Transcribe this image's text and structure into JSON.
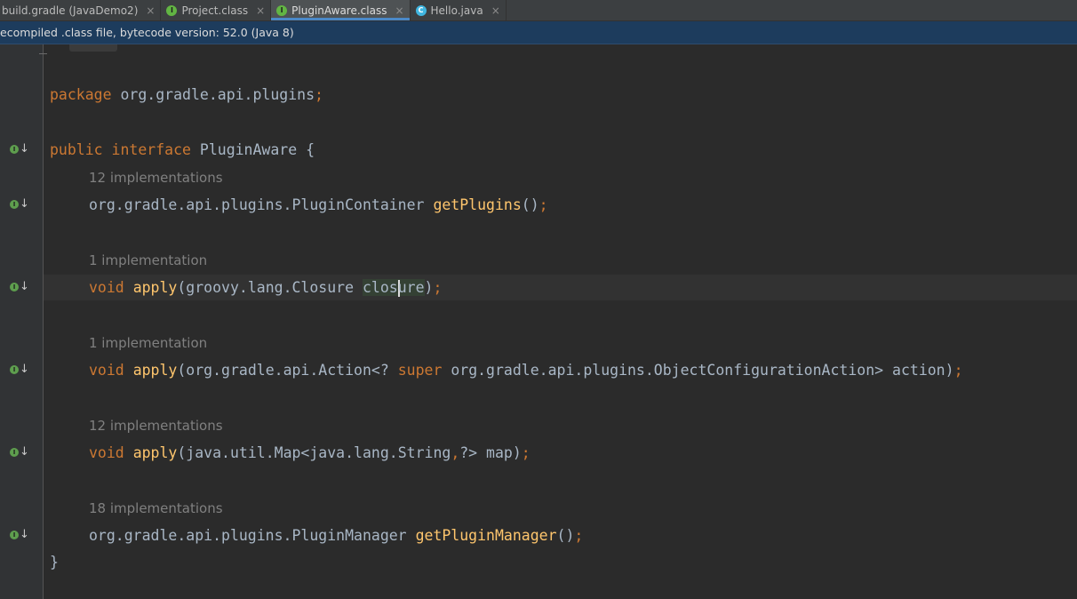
{
  "tabs": [
    {
      "label": "build.gradle (JavaDemo2)",
      "icon": "none",
      "active": false
    },
    {
      "label": "Project.class",
      "icon": "interface-icon",
      "active": false
    },
    {
      "label": "PluginAware.class",
      "icon": "interface-icon",
      "active": true
    },
    {
      "label": "Hello.java",
      "icon": "java-class-icon",
      "active": false
    }
  ],
  "tab_close_glyph": "×",
  "notice": {
    "text": "ecompiled .class file, bytecode version: 52.0 (Java 8)"
  },
  "code": {
    "package_kw": "package",
    "package_name": "org.gradle.api.plugins",
    "semi": ";",
    "public_kw": "public",
    "interface_kw": "interface",
    "iface_name": "PluginAware",
    "open_brace": "{",
    "close_brace": "}",
    "members": [
      {
        "hint": "12 implementations",
        "ret": "org.gradle.api.plugins.PluginContainer",
        "name": "getPlugins",
        "params": "()",
        "end": ";"
      },
      {
        "hint": "1 implementation",
        "ret": "void",
        "name": "apply",
        "params_pre": "(groovy.lang.Closure ",
        "param_hl_a": "clos",
        "param_hl_b": "ure",
        "params_post": ")",
        "end": ";"
      },
      {
        "hint": "1 implementation",
        "ret": "void",
        "name": "apply",
        "params_pre": "(org.gradle.api.Action<? ",
        "super_kw": "super",
        "params_post": " org.gradle.api.plugins.ObjectConfigurationAction> action)",
        "end": ";"
      },
      {
        "hint": "12 implementations",
        "ret": "void",
        "name": "apply",
        "params_pre": "(java.util.Map<java.lang.String",
        "comma": ",",
        "params_post": "?> map)",
        "end": ";"
      },
      {
        "hint": "18 implementations",
        "ret": "org.gradle.api.plugins.PluginManager",
        "name": "getPluginManager",
        "params": "()",
        "end": ";"
      }
    ]
  },
  "colors": {
    "keyword": "#cc7832",
    "method": "#ffc66d",
    "plain": "#a9b7c6",
    "hint": "#808080",
    "notice_bg": "#1d3c5d",
    "editor_bg": "#2b2b2b"
  }
}
